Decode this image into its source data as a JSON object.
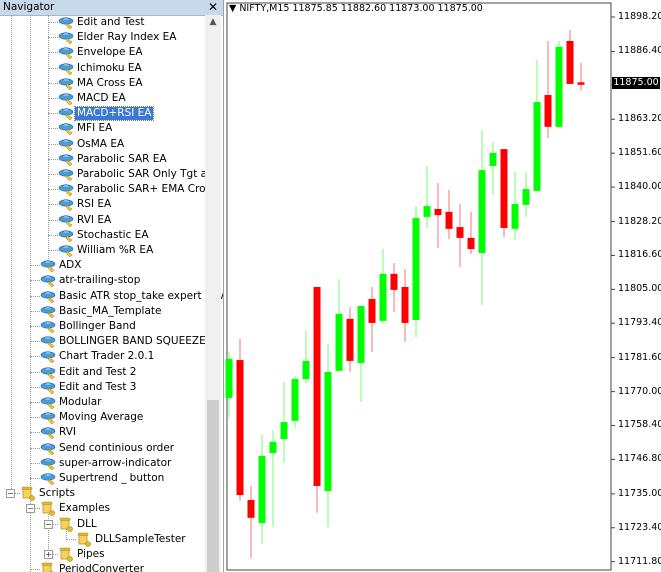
{
  "navigator": {
    "title": "Navigator",
    "close_icon": "close-icon",
    "items": [
      {
        "label": "Edit and Test",
        "level": 3,
        "icon": "expert-advisor-icon"
      },
      {
        "label": "Elder Ray Index EA",
        "level": 3,
        "icon": "expert-advisor-icon"
      },
      {
        "label": "Envelope EA",
        "level": 3,
        "icon": "expert-advisor-icon"
      },
      {
        "label": "Ichimoku EA",
        "level": 3,
        "icon": "expert-advisor-icon"
      },
      {
        "label": "MA Cross EA",
        "level": 3,
        "icon": "expert-advisor-icon"
      },
      {
        "label": "MACD EA",
        "level": 3,
        "icon": "expert-advisor-icon"
      },
      {
        "label": "MACD+RSI EA",
        "level": 3,
        "icon": "expert-advisor-icon",
        "selected": true
      },
      {
        "label": "MFI EA",
        "level": 3,
        "icon": "expert-advisor-icon"
      },
      {
        "label": "OsMA EA",
        "level": 3,
        "icon": "expert-advisor-icon"
      },
      {
        "label": "Parabolic SAR EA",
        "level": 3,
        "icon": "expert-advisor-icon"
      },
      {
        "label": "Parabolic SAR Only Tgt and",
        "level": 3,
        "icon": "expert-advisor-icon"
      },
      {
        "label": "Parabolic SAR+ EMA Cross",
        "level": 3,
        "icon": "expert-advisor-icon"
      },
      {
        "label": "RSI EA",
        "level": 3,
        "icon": "expert-advisor-icon"
      },
      {
        "label": "RVI EA",
        "level": 3,
        "icon": "expert-advisor-icon"
      },
      {
        "label": "Stochastic EA",
        "level": 3,
        "icon": "expert-advisor-icon"
      },
      {
        "label": "William %R EA",
        "level": 3,
        "icon": "expert-advisor-icon"
      },
      {
        "label": "ADX",
        "level": 2,
        "icon": "expert-advisor-icon"
      },
      {
        "label": "atr-trailing-stop",
        "level": 2,
        "icon": "expert-advisor-icon"
      },
      {
        "label": "Basic ATR stop_take expert advi",
        "level": 2,
        "icon": "expert-advisor-icon"
      },
      {
        "label": "Basic_MA_Template",
        "level": 2,
        "icon": "expert-advisor-icon"
      },
      {
        "label": "Bollinger Band",
        "level": 2,
        "icon": "expert-advisor-icon"
      },
      {
        "label": "BOLLINGER BAND SQUEEZE",
        "level": 2,
        "icon": "expert-advisor-icon"
      },
      {
        "label": "Chart Trader 2.0.1",
        "level": 2,
        "icon": "expert-advisor-icon"
      },
      {
        "label": "Edit and Test 2",
        "level": 2,
        "icon": "expert-advisor-icon"
      },
      {
        "label": "Edit and Test 3",
        "level": 2,
        "icon": "expert-advisor-icon"
      },
      {
        "label": "Modular",
        "level": 2,
        "icon": "expert-advisor-icon"
      },
      {
        "label": "Moving Average",
        "level": 2,
        "icon": "expert-advisor-icon"
      },
      {
        "label": "RVI",
        "level": 2,
        "icon": "expert-advisor-icon"
      },
      {
        "label": "Send continious order",
        "level": 2,
        "icon": "expert-advisor-icon"
      },
      {
        "label": "super-arrow-indicator",
        "level": 2,
        "icon": "expert-advisor-icon"
      },
      {
        "label": "Supertrend _ button",
        "level": 2,
        "icon": "expert-advisor-icon"
      },
      {
        "label": "Scripts",
        "level": 1,
        "icon": "script-folder-icon",
        "expander": "collapse"
      },
      {
        "label": "Examples",
        "level": 2,
        "icon": "script-folder-icon",
        "expander": "collapse"
      },
      {
        "label": "DLL",
        "level": 3,
        "icon": "script-folder-icon",
        "expander": "collapse"
      },
      {
        "label": "DLLSampleTester",
        "level": 4,
        "icon": "script-icon"
      },
      {
        "label": "Pipes",
        "level": 3,
        "icon": "script-folder-icon",
        "expander": "expand"
      },
      {
        "label": "PeriodConverter",
        "level": 2,
        "icon": "script-icon"
      }
    ]
  },
  "chart": {
    "header_label": "NIFTY,M15  11875.85 11882.60 11873.00 11875.00",
    "current_price_label": "11875.00",
    "colors": {
      "bull": "#00ff00",
      "bear": "#ff0000",
      "background": "#ffffff",
      "current_price_bg": "#000000"
    }
  },
  "chart_data": {
    "type": "candlestick",
    "symbol": "NIFTY",
    "timeframe": "M15",
    "ylim": [
      11706,
      11902
    ],
    "y_ticks": [
      "11898.20",
      "11886.40",
      "11875.00",
      "11863.20",
      "11851.60",
      "11840.00",
      "11828.20",
      "11816.60",
      "11805.00",
      "11793.40",
      "11781.60",
      "11770.00",
      "11758.40",
      "11746.80",
      "11735.00",
      "11723.40",
      "11711.80"
    ],
    "grid": false,
    "candles": [
      {
        "o": 11767.8,
        "h": 11783.6,
        "l": 11761.3,
        "c": 11781.2
      },
      {
        "o": 11780.8,
        "h": 11788.0,
        "l": 11732.6,
        "c": 11734.6
      },
      {
        "o": 11732.9,
        "h": 11737.7,
        "l": 11713.1,
        "c": 11726.8
      },
      {
        "o": 11725.0,
        "h": 11755.2,
        "l": 11717.9,
        "c": 11748.0
      },
      {
        "o": 11749.0,
        "h": 11756.9,
        "l": 11723.7,
        "c": 11752.8
      },
      {
        "o": 11753.8,
        "h": 11773.3,
        "l": 11745.6,
        "c": 11759.6
      },
      {
        "o": 11760.0,
        "h": 11775.3,
        "l": 11757.6,
        "c": 11774.3
      },
      {
        "o": 11774.3,
        "h": 11791.1,
        "l": 11772.9,
        "c": 11780.5
      },
      {
        "o": 11805.8,
        "h": 11805.8,
        "l": 11728.5,
        "c": 11737.7
      },
      {
        "o": 11736.0,
        "h": 11786.3,
        "l": 11723.7,
        "c": 11776.7
      },
      {
        "o": 11777.1,
        "h": 11808.5,
        "l": 11777.1,
        "c": 11796.6
      },
      {
        "o": 11794.9,
        "h": 11799.0,
        "l": 11776.7,
        "c": 11780.5
      },
      {
        "o": 11779.8,
        "h": 11799.3,
        "l": 11766.5,
        "c": 11799.3
      },
      {
        "o": 11801.7,
        "h": 11805.8,
        "l": 11783.6,
        "c": 11793.5
      },
      {
        "o": 11794.2,
        "h": 11818.8,
        "l": 11793.5,
        "c": 11810.3
      },
      {
        "o": 11810.3,
        "h": 11814.0,
        "l": 11797.3,
        "c": 11804.8
      },
      {
        "o": 11805.8,
        "h": 11812.0,
        "l": 11787.0,
        "c": 11793.5
      },
      {
        "o": 11794.5,
        "h": 11833.5,
        "l": 11788.7,
        "c": 11829.4
      },
      {
        "o": 11829.8,
        "h": 11847.2,
        "l": 11826.0,
        "c": 11833.5
      },
      {
        "o": 11832.5,
        "h": 11841.4,
        "l": 11819.2,
        "c": 11830.4
      },
      {
        "o": 11831.5,
        "h": 11839.0,
        "l": 11822.2,
        "c": 11825.7
      },
      {
        "o": 11826.3,
        "h": 11834.2,
        "l": 11812.6,
        "c": 11822.6
      },
      {
        "o": 11822.6,
        "h": 11831.5,
        "l": 11817.1,
        "c": 11818.8
      },
      {
        "o": 11817.4,
        "h": 11859.5,
        "l": 11799.6,
        "c": 11845.8
      },
      {
        "o": 11847.2,
        "h": 11855.4,
        "l": 11837.3,
        "c": 11851.7
      },
      {
        "o": 11853.0,
        "h": 11853.0,
        "l": 11822.9,
        "c": 11826.0
      },
      {
        "o": 11825.7,
        "h": 11845.2,
        "l": 11821.9,
        "c": 11834.2
      },
      {
        "o": 11833.9,
        "h": 11845.2,
        "l": 11829.8,
        "c": 11839.3
      },
      {
        "o": 11838.7,
        "h": 11883.5,
        "l": 11838.7,
        "c": 11869.1
      },
      {
        "o": 11871.5,
        "h": 11890.0,
        "l": 11856.8,
        "c": 11860.6
      },
      {
        "o": 11860.6,
        "h": 11890.0,
        "l": 11860.6,
        "c": 11888.0
      },
      {
        "o": 11890.0,
        "h": 11893.8,
        "l": 11875.3,
        "c": 11875.3
      },
      {
        "o": 11875.85,
        "h": 11882.6,
        "l": 11873.0,
        "c": 11875.0
      }
    ]
  }
}
